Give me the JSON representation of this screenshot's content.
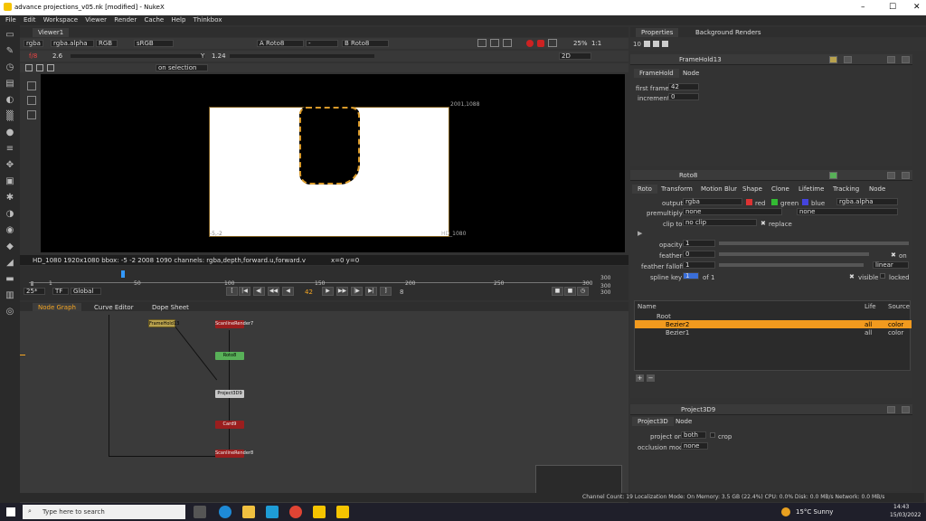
{
  "window": {
    "title": "advance projections_v05.nk [modified] - NukeX"
  },
  "menu": [
    "File",
    "Edit",
    "Workspace",
    "Viewer",
    "Render",
    "Cache",
    "Help",
    "Thinkbox"
  ],
  "viewer": {
    "tab": "Viewer1",
    "channels": "rgba",
    "alpha": "rgba.alpha",
    "rgb": "RGB",
    "lut": "sRGB",
    "input_a": "A  Roto8",
    "input_a_op": "-",
    "input_b": "B  Roto8",
    "zoom": "25%",
    "ratio": "1:1",
    "gain_label": "f/8",
    "gain": "2.6",
    "gamma_label": "Y",
    "gamma": "1.24",
    "view_mode": "2D",
    "on_selection": "on selection",
    "corner_tr": "2001,1088",
    "corner_bl": "-5,-2",
    "corner_br": "HD_1080",
    "info": "HD_1080 1920x1080  bbox: -5 -2 2008 1090 channels: rgba,depth,forward.u,forward.v",
    "coords": "x=0 y=0"
  },
  "timeline": {
    "ticks": [
      "1",
      "50",
      "100",
      "150",
      "200",
      "250",
      "300"
    ],
    "end_a": "300",
    "end_b": "300",
    "fps": "25*",
    "tf": "TF",
    "scope": "Global",
    "current_frame": "42",
    "step": "8",
    "end_frame": "300"
  },
  "graph": {
    "tabs": [
      "Node Graph",
      "Curve Editor",
      "Dope Sheet"
    ],
    "nodes": {
      "framehold": "FrameHold13",
      "scanline1": "ScanlineRender7",
      "roto": "Roto8",
      "project": "Project3D9",
      "card": "Card9",
      "scanline2": "ScanlineRender8"
    }
  },
  "properties": {
    "tabs": [
      "Properties",
      "Background Renders"
    ],
    "count": "10",
    "framehold": {
      "title": "FrameHold13",
      "tabs": [
        "FrameHold",
        "Node"
      ],
      "first_frame_label": "first frame",
      "first_frame": "42",
      "increment_label": "increment",
      "increment": "0"
    },
    "roto": {
      "title": "Roto8",
      "tabs": [
        "Roto",
        "Transform",
        "Motion Blur",
        "Shape",
        "Clone",
        "Lifetime",
        "Tracking",
        "Node"
      ],
      "output_label": "output",
      "output": "rgba",
      "red": "red",
      "green": "green",
      "blue": "blue",
      "alpha_out": "rgba.alpha",
      "premultiply_label": "premultiply",
      "premultiply": "none",
      "premult2": "none",
      "clipto_label": "clip to",
      "clipto": "no clip",
      "replace": "replace",
      "opacity_label": "opacity",
      "opacity": "1",
      "feather_label": "feather",
      "feather": "0",
      "feather_on": "on",
      "falloff_label": "feather falloff",
      "falloff": "1",
      "falloff_type": "linear",
      "splinekey_label": "spline key",
      "splinekey": "1",
      "splinekey_of": "of 1",
      "visible": "visible",
      "locked": "locked",
      "cols": [
        "Name",
        "Life",
        "Source"
      ],
      "rows": [
        {
          "name": "Root",
          "life": "",
          "source": ""
        },
        {
          "name": "Bezier2",
          "life": "all",
          "source": "color"
        },
        {
          "name": "Bezier1",
          "life": "all",
          "source": "color"
        }
      ]
    },
    "project": {
      "title": "Project3D9",
      "tabs": [
        "Project3D",
        "Node"
      ],
      "project_on_label": "project on",
      "project_on": "both",
      "crop": "crop",
      "occlusion_label": "occlusion mode",
      "occlusion": "none"
    }
  },
  "status": "Channel Count: 19  Localization Mode: On  Memory: 3.5 GB (22.4%)  CPU: 0.0%  Disk: 0.0 MB/s  Network: 0.0 MB/s",
  "taskbar": {
    "search_placeholder": "Type here to search",
    "weather": "15°C  Sunny",
    "time": "14:43",
    "date": "15/03/2022"
  }
}
